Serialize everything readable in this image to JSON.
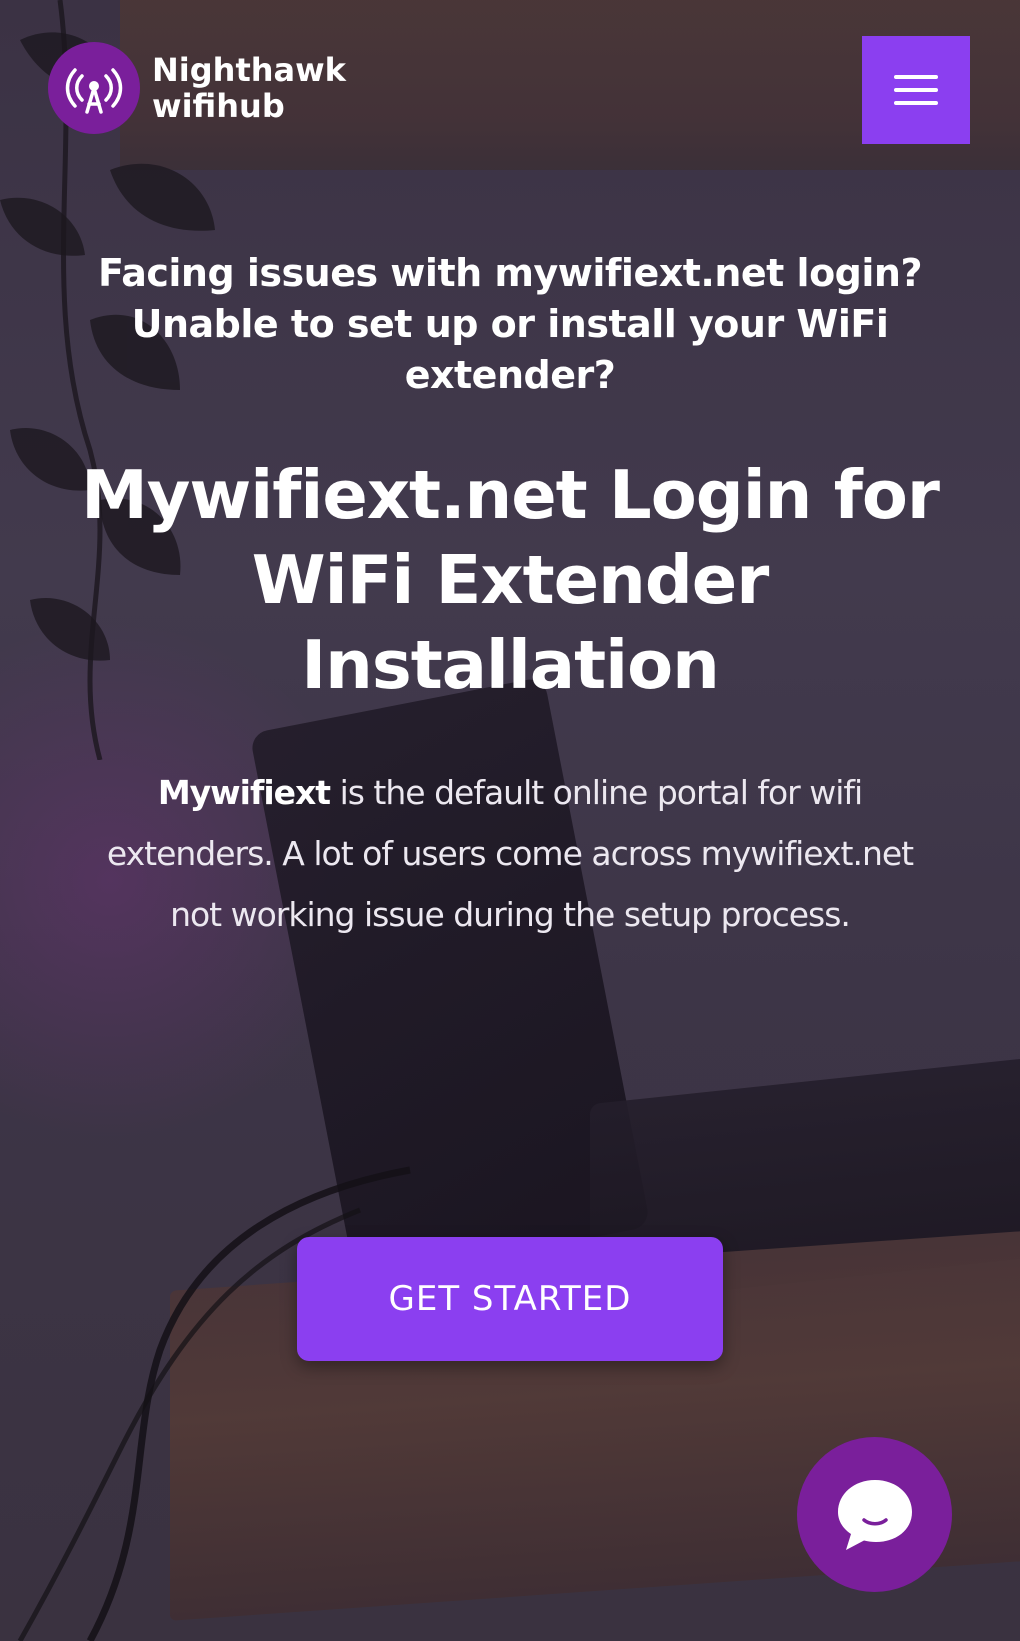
{
  "brand": {
    "line1": "Nighthawk",
    "line2": "wifihub",
    "icon": "wifi-antenna-icon",
    "accent_color": "#8b3ff0",
    "badge_color": "#7a1f9b"
  },
  "header": {
    "menu_icon": "hamburger-menu-icon"
  },
  "hero": {
    "subheading": "Facing issues with mywifiext.net login? Unable to set up or install your WiFi extender?",
    "title": "Mywifiext.net Login for WiFi Extender Installation",
    "description_brand": "Mywifiext",
    "description_rest": " is the default online portal for wifi extenders. A lot of users come across mywifiext.net not working issue during the setup process.",
    "cta_label": "GET STARTED"
  },
  "chat": {
    "icon": "chat-bubble-icon"
  }
}
